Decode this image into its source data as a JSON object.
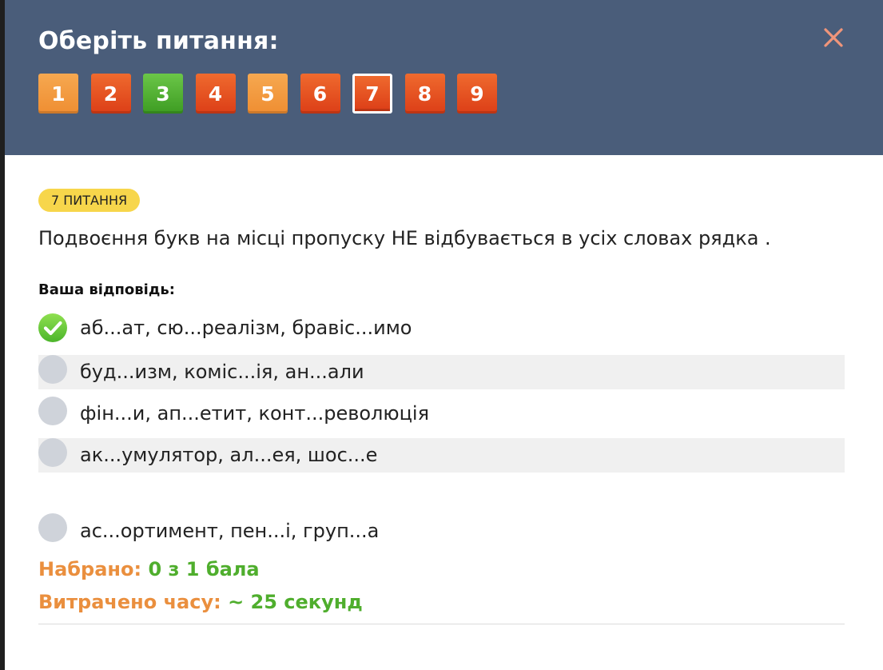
{
  "header": {
    "title": "Оберіть питання:",
    "close_icon": "close-icon",
    "questions": [
      {
        "label": "1",
        "style": "light"
      },
      {
        "label": "2",
        "style": "red"
      },
      {
        "label": "3",
        "style": "green"
      },
      {
        "label": "4",
        "style": "red"
      },
      {
        "label": "5",
        "style": "light"
      },
      {
        "label": "6",
        "style": "red"
      },
      {
        "label": "7",
        "style": "red",
        "active": true
      },
      {
        "label": "8",
        "style": "red"
      },
      {
        "label": "9",
        "style": "red"
      }
    ]
  },
  "question": {
    "badge": "7 ПИТАННЯ",
    "text": "Подвоєння букв на місці пропуску НЕ відбувається в усіх словах рядка ."
  },
  "answer": {
    "heading": "Ваша відповідь:",
    "options": [
      {
        "label": "аб...ат, сю...реалізм, бравіс...имо",
        "checked": true,
        "icon": "check-icon"
      },
      {
        "label": "буд...изм, коміс...ія, ан...али",
        "checked": false
      },
      {
        "label": "фін...и, ап...етит, конт...революція",
        "checked": false
      },
      {
        "label": "ак...умулятор, ал...ея, шос...е",
        "checked": false
      },
      {
        "label": "ас...ортимент, пен...і, груп...а",
        "checked": false
      }
    ]
  },
  "stats": {
    "score_label": "Набрано:",
    "score_value": "0 з 1 бала",
    "time_label": "Витрачено часу:",
    "time_value": "~ 25 секунд"
  },
  "colors": {
    "header_bg": "#4a5d7a",
    "badge_bg": "#f7d64b",
    "stat_key": "#ea8f3e",
    "stat_value": "#4fae2d",
    "close_icon": "#f0957a"
  }
}
